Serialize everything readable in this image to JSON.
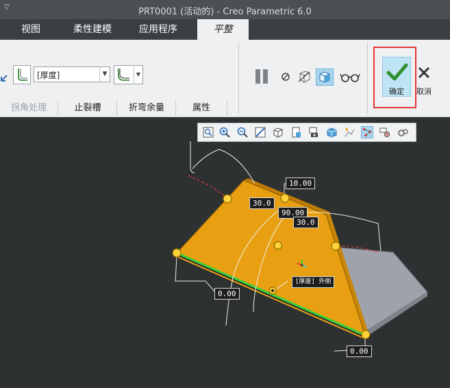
{
  "window": {
    "title": "PRT0001 (活动的) - Creo Parametric 6.0"
  },
  "tabs": [
    {
      "label": "视图"
    },
    {
      "label": "柔性建模"
    },
    {
      "label": "应用程序"
    },
    {
      "label": "平整"
    }
  ],
  "ribbon": {
    "thickness_select": {
      "value": "[厚度]"
    },
    "subtabs": [
      {
        "label": "拐角处理"
      },
      {
        "label": "止裂槽"
      },
      {
        "label": "折弯余量"
      },
      {
        "label": "属性"
      }
    ],
    "ok_label": "确定",
    "cancel_label": "取消"
  },
  "graphics": {
    "labels": {
      "top_dim": "10.00",
      "angle_left": "30.0",
      "angle_mid": "90.00",
      "angle_right": "30.0",
      "edge_left": "0.00",
      "edge_bottom": "0.00",
      "thickness_side": "[厚度] 外侧"
    }
  },
  "colors": {
    "accent": "#e8a012",
    "edge_highlight": "#38d23a",
    "ok_outline": "#e63535"
  }
}
